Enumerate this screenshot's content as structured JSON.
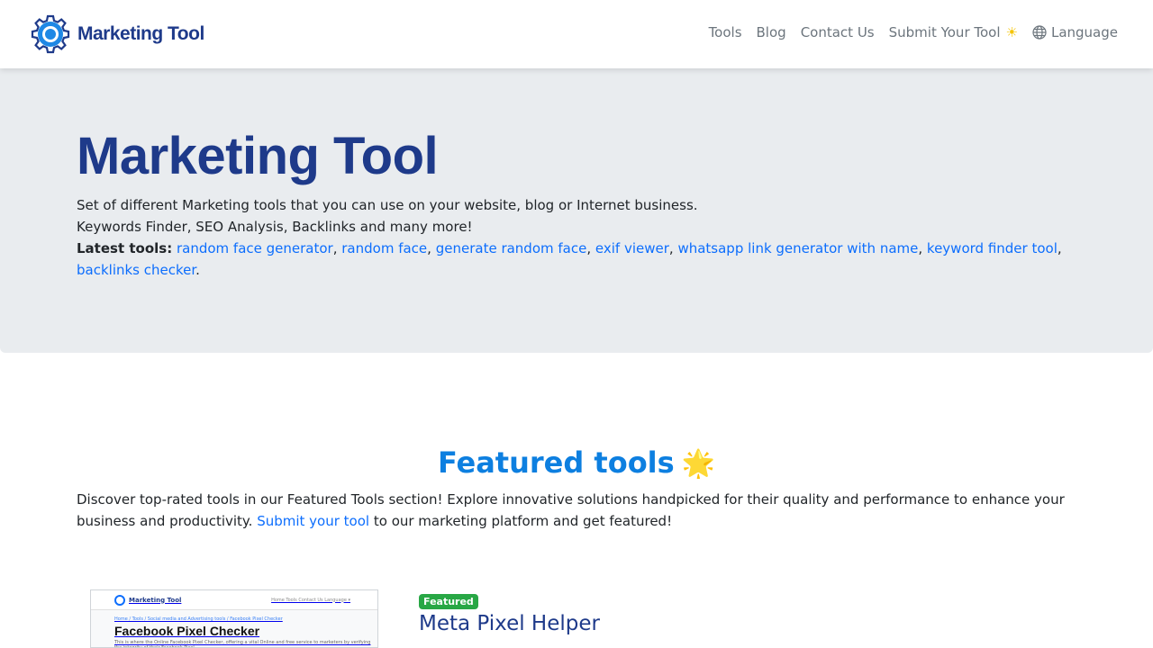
{
  "brand": {
    "name": "Marketing Tool"
  },
  "nav": {
    "tools": "Tools",
    "blog": "Blog",
    "contact": "Contact Us",
    "submit": "Submit Your Tool",
    "submit_icon": "☀",
    "language": "Language"
  },
  "hero": {
    "title": "Marketing Tool",
    "line1": "Set of different Marketing tools that you can use on your website, blog or Internet business.",
    "line2": "Keywords Finder, SEO Analysis, Backlinks and many more!",
    "latest_label": "Latest tools:",
    "latest_tools": [
      "random face generator",
      "random face",
      "generate random face",
      "exif viewer",
      "whatsapp link generator with name",
      "keyword finder tool",
      "backlinks checker"
    ]
  },
  "featured": {
    "title": "Featured tools",
    "star": "🌟",
    "desc_before": "Discover top-rated tools in our Featured Tools section! Explore innovative solutions handpicked for their quality and performance to enhance your business and productivity. ",
    "desc_link": "Submit your tool",
    "desc_after": " to our marketing platform and get featured!"
  },
  "card": {
    "badge": "Featured",
    "title": "Meta Pixel Helper",
    "thumb": {
      "brand": "Marketing Tool",
      "menu": "Home   Tools   Contact Us   Language ▾",
      "crumb": "Home / Tools / Social media and Advertising tools / Facebook Pixel Checker",
      "title": "Facebook Pixel Checker",
      "line": "This is where the Online Facebook Pixel Checker, offering a vital Online and free service to marketers by verifying the integrity of their Facebook Pixel"
    }
  },
  "colors": {
    "brand": "#1e3a8a",
    "link": "#0d6efd",
    "hero_bg": "#e9ecef",
    "badge": "#28a745"
  }
}
